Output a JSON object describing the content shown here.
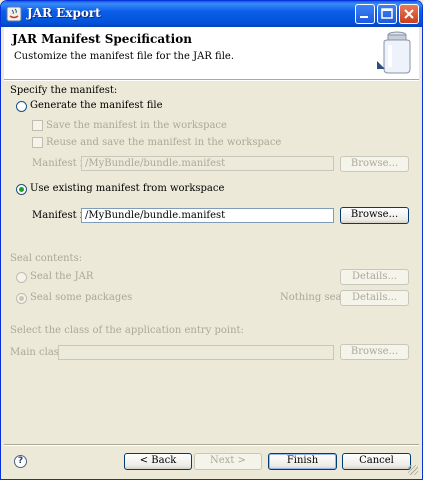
{
  "window": {
    "title": "JAR Export"
  },
  "banner": {
    "title": "JAR Manifest Specification",
    "description": "Customize the manifest file for the JAR file."
  },
  "manifest": {
    "section_label": "Specify the manifest:",
    "generate_label": "Generate the manifest file",
    "save_label": "Save the manifest in the workspace",
    "reuse_label": "Reuse and save the manifest in the workspace",
    "generate_file_label": "Manifest file:",
    "generate_file_value": "/MyBundle/bundle.manifest",
    "generate_browse": "Browse...",
    "existing_label": "Use existing manifest from workspace",
    "existing_file_label": "Manifest file:",
    "existing_file_value": "/MyBundle/bundle.manifest",
    "existing_browse": "Browse...",
    "selected": "existing"
  },
  "seal": {
    "section_label": "Seal contents:",
    "seal_jar_label": "Seal the JAR",
    "seal_jar_details": "Details...",
    "seal_some_label": "Seal some packages",
    "status": "Nothing sealed",
    "seal_some_details": "Details...",
    "selected": "seal_some"
  },
  "entry": {
    "section_label": "Select the class of the application entry point:",
    "main_class_label": "Main class:",
    "main_class_value": "",
    "browse": "Browse..."
  },
  "footer": {
    "help": "?",
    "back": "< Back",
    "next": "Next >",
    "finish": "Finish",
    "cancel": "Cancel"
  }
}
